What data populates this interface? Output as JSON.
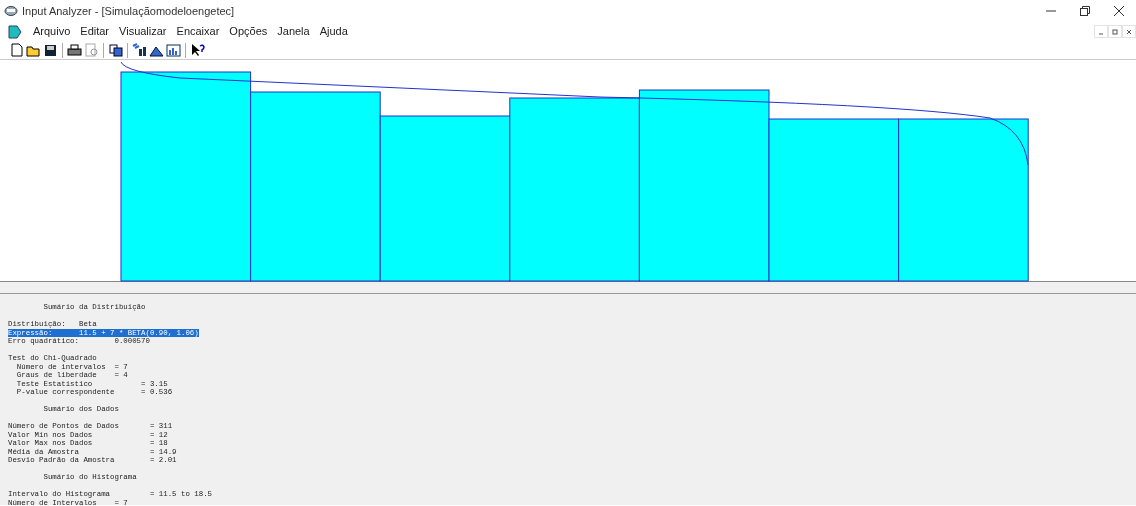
{
  "window": {
    "title": "Input Analyzer - [Simulaçãomodeloengetec]"
  },
  "menu": [
    "Arquivo",
    "Editar",
    "Visualizar",
    "Encaixar",
    "Opções",
    "Janela",
    "Ajuda"
  ],
  "report": [
    {
      "lines": [
        {
          "text": "        Sumário da Distribuição",
          "selected": false
        }
      ]
    },
    {
      "lines": [
        {
          "text": "Distribuição:   Beta",
          "selected": false
        },
        {
          "text": "Expressão:      11.5 + 7 * BETA(0.90, 1.06)",
          "selected": true
        },
        {
          "text": "Erro quadrático:        0.000570",
          "selected": false
        }
      ]
    },
    {
      "lines": [
        {
          "text": "Test do Chi-Quadrado",
          "selected": false
        },
        {
          "text": "  Número de intervalos  = 7",
          "selected": false
        },
        {
          "text": "  Graus de liberdade    = 4",
          "selected": false
        },
        {
          "text": "  Teste Estatístico           = 3.15",
          "selected": false
        },
        {
          "text": "  P-value correspondente      = 0.536",
          "selected": false
        }
      ]
    },
    {
      "lines": [
        {
          "text": "        Sumário dos Dados",
          "selected": false
        }
      ]
    },
    {
      "lines": [
        {
          "text": "Número de Pontos de Dados       = 311",
          "selected": false
        },
        {
          "text": "Valor Min nos Dados             = 12",
          "selected": false
        },
        {
          "text": "Valor Max nos Dados             = 18",
          "selected": false
        },
        {
          "text": "Média da Amostra                = 14.9",
          "selected": false
        },
        {
          "text": "Desvio Padrão da Amostra        = 2.01",
          "selected": false
        }
      ]
    },
    {
      "lines": [
        {
          "text": "        Sumário do Histograma",
          "selected": false
        }
      ]
    },
    {
      "lines": [
        {
          "text": "Intervalo do Histograma         = 11.5 to 18.5",
          "selected": false
        },
        {
          "text": "Número de Intervalos    = 7",
          "selected": false
        }
      ]
    }
  ]
}
